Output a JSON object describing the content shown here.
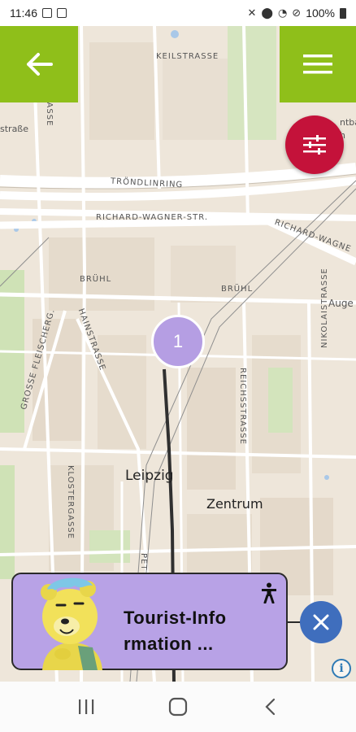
{
  "status_bar": {
    "time": "11:46",
    "battery": "100%",
    "left_icons": [
      "image-icon",
      "app-icon"
    ],
    "right_icons": [
      "mute-icon",
      "location-icon",
      "wifi-icon",
      "dnd-icon",
      "battery-icon"
    ]
  },
  "header": {
    "back_icon": "arrow-left-icon",
    "menu_icon": "hamburger-menu-icon",
    "accent_color": "#8fbf1a"
  },
  "filter_button": {
    "icon": "sliders-icon",
    "color": "#c4123a"
  },
  "map": {
    "street_labels": [
      "KEILSTRASSE",
      "LÖHRSTRASSE",
      "straße",
      "TRÖNDLINRING",
      "RICHARD-WAGNER-STR.",
      "RICHARD-WAGNE",
      "BRÜHL",
      "BRÜHL",
      "Auge",
      "GROSSE FLEISCHERG.",
      "HAINSTRASSE",
      "REICHSSTRASSE",
      "NIKOLAISTRASSE",
      "KLOSTERGASSE",
      "PET",
      "ntba",
      "h"
    ],
    "place_labels": [
      "Leipzig",
      "Zentrum"
    ],
    "cluster_count": "1",
    "cluster_color": "#b59ee3"
  },
  "poi_card": {
    "title_line1": "Tourist-Info",
    "title_line2": "rmation ...",
    "accessibility_icon": "accessibility-icon",
    "background": "#b8a2e6"
  },
  "close_button": {
    "icon": "close-icon",
    "color": "#3f6ebd"
  },
  "info_button": {
    "label": "i"
  },
  "nav_bar": {
    "items": [
      "recent-apps-icon",
      "home-icon",
      "back-icon"
    ]
  }
}
